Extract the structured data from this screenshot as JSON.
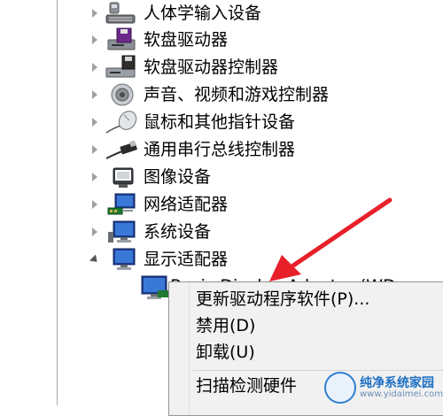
{
  "tree": {
    "items": [
      {
        "label": "人体学输入设备",
        "icon": "hid-icon",
        "expanded": false
      },
      {
        "label": "软盘驱动器",
        "icon": "floppy-drive-icon",
        "expanded": false
      },
      {
        "label": "软盘驱动器控制器",
        "icon": "floppy-controller-icon",
        "expanded": false
      },
      {
        "label": "声音、视频和游戏控制器",
        "icon": "speaker-icon",
        "expanded": false
      },
      {
        "label": "鼠标和其他指针设备",
        "icon": "mouse-icon",
        "expanded": false
      },
      {
        "label": "通用串行总线控制器",
        "icon": "usb-icon",
        "expanded": false
      },
      {
        "label": "图像设备",
        "icon": "camera-icon",
        "expanded": false
      },
      {
        "label": "网络适配器",
        "icon": "network-adapter-icon",
        "expanded": false
      },
      {
        "label": "系统设备",
        "icon": "system-device-icon",
        "expanded": false
      },
      {
        "label": "显示适配器",
        "icon": "display-adapter-icon",
        "expanded": true
      }
    ],
    "child": {
      "label": "Basic Display Adapter (WD",
      "icon": "monitor-icon"
    }
  },
  "context_menu": {
    "items": [
      {
        "label": "更新驱动程序软件(P)..."
      },
      {
        "label": "禁用(D)"
      },
      {
        "label": "卸载(U)"
      },
      {
        "label": "扫描检测硬件"
      }
    ]
  },
  "watermark": {
    "text": "纯净系统家园",
    "url": "www.yidaimei.com"
  },
  "colors": {
    "arrow": "#e8202a",
    "tree_line": "#a9a9a9",
    "menu_bg": "#f1f1f1"
  }
}
